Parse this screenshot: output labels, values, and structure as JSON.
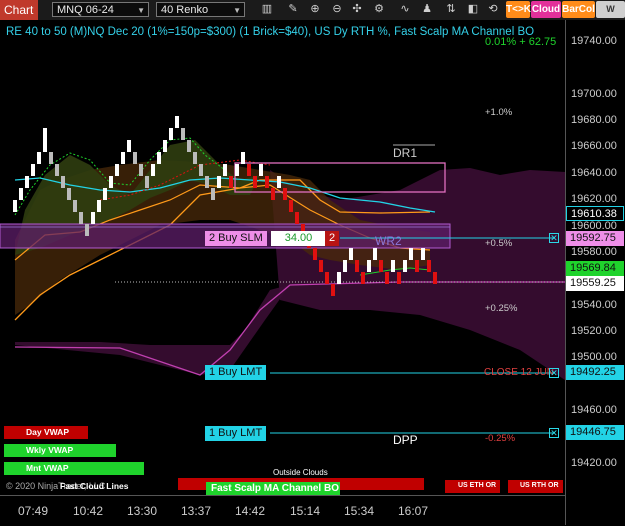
{
  "toolbar": {
    "chart_label": "Chart",
    "instrument": "MNQ 06-24",
    "bar_type": "40 Renko",
    "tk_label": "T<>K",
    "cloud_label": "Cloud",
    "barcol_label": "BarCol",
    "w_vwap_label": "W VWAP"
  },
  "chart_title": "RE 40 to 50 (M)NQ Dec 20 (1%=150p=$300) (1 Brick=$40), US Dy RTH %, Fast Scalp MA Channel BO",
  "top_pct_label": "0.01% + 62.75",
  "y_ticks": [
    "19740.00",
    "19720.00",
    "19700.00",
    "19680.00",
    "19660.00",
    "19640.00",
    "19620.00",
    "19600.00",
    "19580.00",
    "19560.00",
    "19540.00",
    "19520.00",
    "19500.00",
    "19480.00",
    "19460.00",
    "19440.00",
    "19420.00"
  ],
  "x_ticks": [
    "07:49",
    "10:42",
    "13:30",
    "13:37",
    "14:42",
    "15:14",
    "15:34",
    "16:07"
  ],
  "price_flags": {
    "p1": "19610.38",
    "p2": "19592.75",
    "p3": "19569.84",
    "p4": "19559.25",
    "p5": "19492.25",
    "p6": "19446.75"
  },
  "levels": {
    "dr1": "DR1",
    "wr2": "WR2",
    "dpp": "DPP",
    "close_label": "CLOSE 12 JUN"
  },
  "pct_labels": {
    "p1": "+1.0%",
    "p05": "+0.5%",
    "p025": "+0.25%",
    "m025": "-0.25%"
  },
  "orders": {
    "buy_slm": "2 Buy SLM",
    "buy_slm_price": "34.00",
    "buy_slm_qty": "2",
    "buy_lmt_1": "1 Buy LMT",
    "buy_lmt_2": "1 Buy LMT"
  },
  "legend": {
    "day_vwap": "Day VWAP",
    "wkly_vwap": "Wkly VWAP",
    "mnt_vwap": "Mnt VWAP",
    "outside_clouds": "Outside Clouds",
    "copyright": "© 2020 NinjaTrader, LLC",
    "fast_cloud_lines": "Fast Cloud Lines",
    "fast_scalp": "Fast Scalp MA Channel BO",
    "us_eth_or": "US ETH OR",
    "us_rth_or": "US RTH OR"
  },
  "colors": {
    "up_brick": "#ffffff",
    "down_brick": "#e01010",
    "cyan": "#22d3e6",
    "orange": "#ff9a1a",
    "magenta": "#c040b0",
    "green": "#1fd32c",
    "red_tab": "#c0392b"
  }
}
